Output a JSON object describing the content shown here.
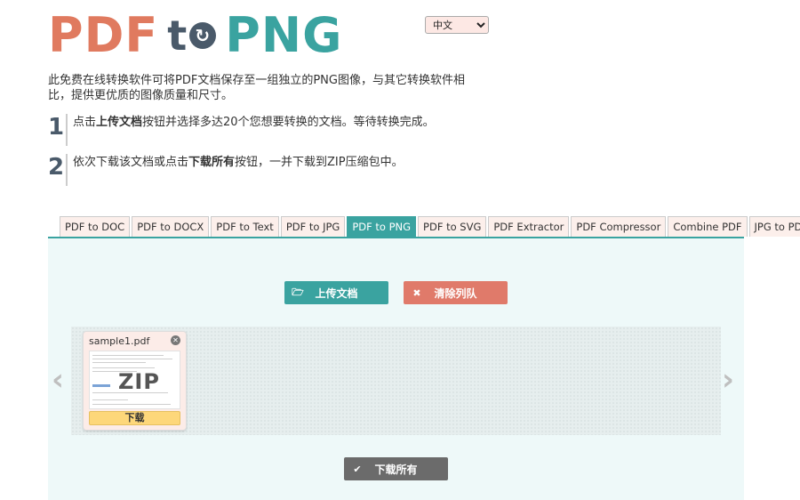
{
  "logo": {
    "part1": "PDF",
    "part2": "t",
    "part3": "PNG"
  },
  "language": {
    "selected": "中文"
  },
  "intro": "此免费在线转换软件可将PDF文档保存至一组独立的PNG图像，与其它转换软件相比，提供更优质的图像质量和尺寸。",
  "steps": [
    {
      "num": "1",
      "pre": "点击",
      "bold": "上传文档",
      "post": "按钮并选择多达20个您想要转换的文档。等待转换完成。"
    },
    {
      "num": "2",
      "pre": "依次下载该文档或点击",
      "bold": "下载所有",
      "post": "按钮，一并下载到ZIP压缩包中。"
    }
  ],
  "tabs": [
    "PDF to DOC",
    "PDF to DOCX",
    "PDF to Text",
    "PDF to JPG",
    "PDF to PNG",
    "PDF to SVG",
    "PDF Extractor",
    "PDF Compressor",
    "Combine PDF",
    "JPG to PDF"
  ],
  "active_tab": "PDF to PNG",
  "buttons": {
    "upload": "上传文档",
    "clear": "清除列队",
    "download_all": "下载所有"
  },
  "file": {
    "name": "sample1.pdf",
    "download": "下载",
    "thumb_text": "ZIP"
  },
  "colors": {
    "accent": "#3aa3a0",
    "coral": "#e07a5f",
    "dark": "#4a5a6a",
    "yellow": "#fdd77a"
  }
}
